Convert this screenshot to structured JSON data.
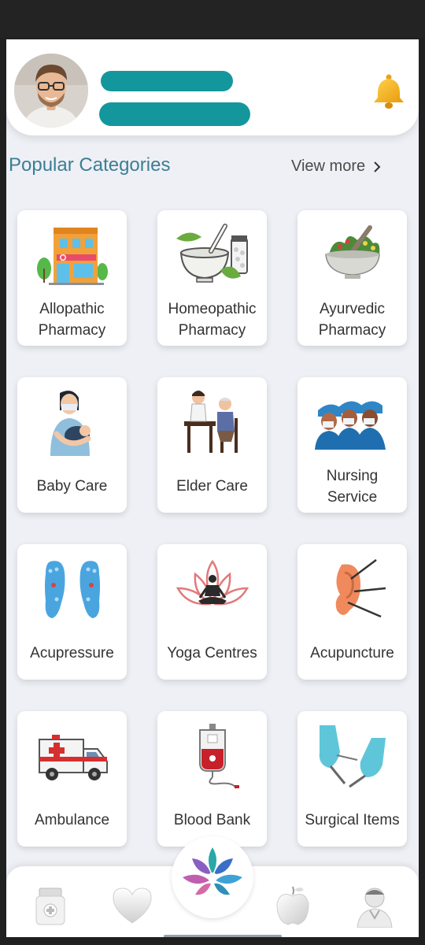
{
  "header": {
    "avatar_icon": "user-avatar",
    "bell_icon": "bell-icon",
    "name_placeholder_color": "#14979c"
  },
  "section": {
    "title": "Popular Categories",
    "view_more": "View more",
    "chevron": "›"
  },
  "categories": [
    {
      "label_lines": [
        "Allopathic",
        "Pharmacy"
      ],
      "icon": "pharmacy-building-icon"
    },
    {
      "label_lines": [
        "Homeopathic",
        "Pharmacy"
      ],
      "icon": "mortar-pestle-pills-icon"
    },
    {
      "label_lines": [
        "Ayurvedic",
        "Pharmacy"
      ],
      "icon": "herbal-bowl-icon"
    },
    {
      "label_lines": [
        "Baby Care"
      ],
      "icon": "nurse-with-baby-icon"
    },
    {
      "label_lines": [
        "Elder Care"
      ],
      "icon": "elder-care-icon"
    },
    {
      "label_lines": [
        "Nursing",
        "Service"
      ],
      "icon": "nurses-icon"
    },
    {
      "label_lines": [
        "Acupressure"
      ],
      "icon": "feet-acupressure-icon"
    },
    {
      "label_lines": [
        "Yoga Centres"
      ],
      "icon": "lotus-meditation-icon"
    },
    {
      "label_lines": [
        "Acupuncture"
      ],
      "icon": "ear-needles-icon"
    },
    {
      "label_lines": [
        "Ambulance"
      ],
      "icon": "ambulance-icon"
    },
    {
      "label_lines": [
        "Blood Bank"
      ],
      "icon": "blood-bag-icon"
    },
    {
      "label_lines": [
        "Surgical Items"
      ],
      "icon": "surgical-gloves-icon"
    }
  ],
  "bottom_nav": [
    "medicine-jar-icon",
    "heart-icon",
    "lotus-logo-icon",
    "apple-icon",
    "doctor-profile-icon"
  ],
  "colors": {
    "accent": "#14979c",
    "title": "#3b7e95",
    "background": "#eef0f5"
  }
}
